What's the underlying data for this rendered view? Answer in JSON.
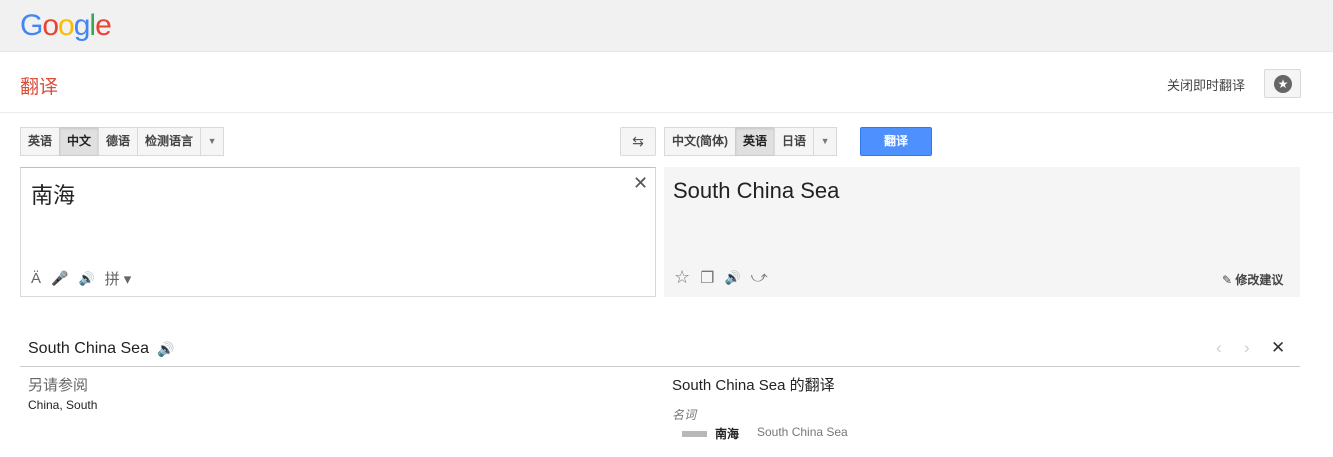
{
  "header": {
    "logo_letters": [
      {
        "ch": "G",
        "color": "#4285f4"
      },
      {
        "ch": "o",
        "color": "#ea4335"
      },
      {
        "ch": "o",
        "color": "#fbbc05"
      },
      {
        "ch": "g",
        "color": "#4285f4"
      },
      {
        "ch": "l",
        "color": "#34a853"
      },
      {
        "ch": "e",
        "color": "#ea4335"
      }
    ]
  },
  "titlebar": {
    "title": "翻译",
    "instant_toggle": "关闭即时翻译",
    "star_icon": "star-icon"
  },
  "source_langs": [
    {
      "label": "英语",
      "selected": false
    },
    {
      "label": "中文",
      "selected": true
    },
    {
      "label": "德语",
      "selected": false
    },
    {
      "label": "检测语言",
      "selected": false
    }
  ],
  "target_langs": [
    {
      "label": "中文(简体)",
      "selected": false
    },
    {
      "label": "英语",
      "selected": true
    },
    {
      "label": "日语",
      "selected": false
    }
  ],
  "buttons": {
    "swap": "⇆",
    "translate": "翻译",
    "more": "▼"
  },
  "source": {
    "text": "南海",
    "clear": "✕",
    "tools": {
      "accent": "Ä",
      "mic": "🎤",
      "speaker": "🔊",
      "ime": "拼 ▾"
    }
  },
  "output": {
    "text": "South China Sea",
    "tools": {
      "star": "☆",
      "copy": "❐",
      "speaker": "🔊",
      "share": "⤻"
    },
    "suggest": "✎ 修改建议"
  },
  "dictionary": {
    "word": "South China Sea",
    "speaker": "🔊",
    "prev": "‹",
    "next": "›",
    "close": "✕",
    "see_also_title": "另请参阅",
    "see_also_links": "China, South",
    "translations_title": "South China Sea 的翻译",
    "part_of_speech": "名词",
    "entries": [
      {
        "word": "南海",
        "translation": "South China Sea"
      }
    ]
  }
}
